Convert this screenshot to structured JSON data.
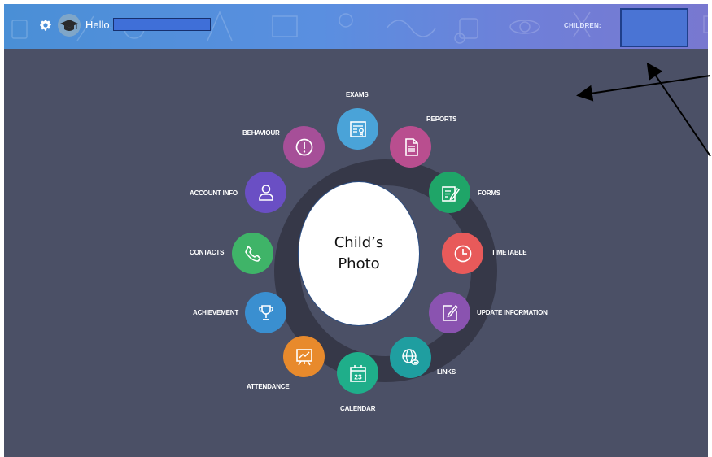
{
  "header": {
    "greeting": "Hello,",
    "children_label": "CHILDREN:"
  },
  "photo": {
    "line1": "Child’s",
    "line2": "Photo"
  },
  "menu": {
    "exams": "EXAMS",
    "reports": "REPORTS",
    "forms": "FORMS",
    "timetable": "TIMETABLE",
    "update_information": "UPDATE INFORMATION",
    "links": "LINKS",
    "calendar": "CALENDAR",
    "calendar_day": "23",
    "attendance": "ATTENDANCE",
    "achievement": "ACHIEVEMENT",
    "contacts": "CONTACTS",
    "account_info": "ACCOUNT INFO",
    "behaviour": "BEHAVIOUR"
  },
  "colors": {
    "exams": "#4aa3d8",
    "reports": "#b94e8f",
    "forms": "#1fa568",
    "timetable": "#e85a5a",
    "update_information": "#8a53b0",
    "links": "#1f9ea0",
    "calendar": "#1fae8a",
    "attendance": "#e88a2c",
    "achievement": "#3a8fd0",
    "contacts": "#3fb468",
    "account_info": "#6a4fc4",
    "behaviour": "#a64f98"
  },
  "icons": {
    "exams": "certificate-icon",
    "reports": "document-icon",
    "forms": "form-edit-icon",
    "timetable": "clock-icon",
    "update_information": "edit-icon",
    "links": "globe-link-icon",
    "calendar": "calendar-icon",
    "attendance": "chart-board-icon",
    "achievement": "trophy-icon",
    "contacts": "phone-icon",
    "account_info": "user-icon",
    "behaviour": "alert-icon",
    "settings": "gear-icon",
    "avatar": "graduation-cap-icon"
  }
}
